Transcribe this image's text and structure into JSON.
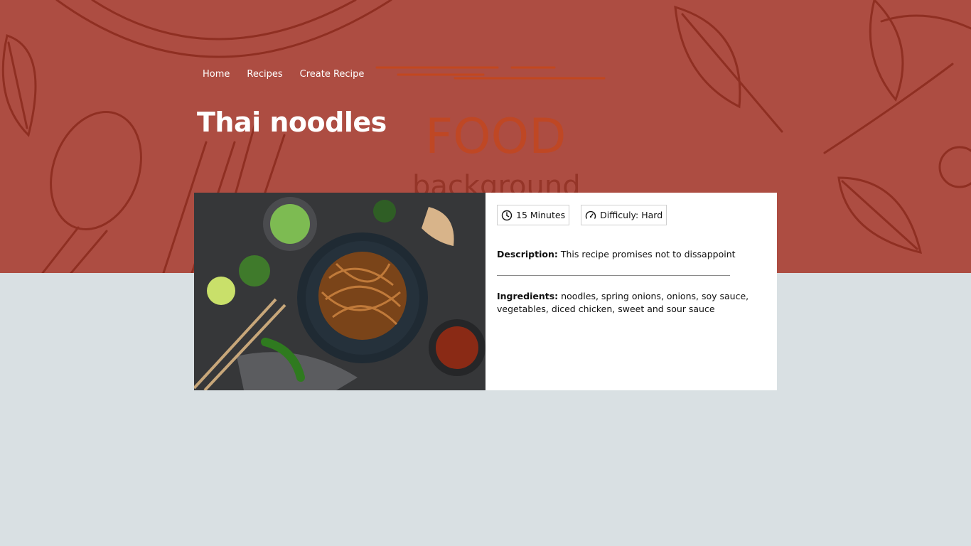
{
  "nav": {
    "items": [
      {
        "label": "Home"
      },
      {
        "label": "Recipes"
      },
      {
        "label": "Create Recipe"
      }
    ]
  },
  "hero": {
    "background_text_1": "FOOD",
    "background_text_2": "background",
    "color": "#ad4d42"
  },
  "recipe": {
    "title": "Thai noodles",
    "time": "15 Minutes",
    "difficulty": "Difficuly: Hard",
    "description_label": "Description:",
    "description": "This recipe promises not to dissappoint",
    "ingredients_label": "Ingredients:",
    "ingredients": "noodles, spring onions, onions, soy sauce, vegetables, diced chicken, sweet and sour sauce"
  },
  "icons": {
    "time": "clock-icon",
    "difficulty": "gauge-icon"
  },
  "colors": {
    "page_bg": "#d9e0e3",
    "card_bg": "#ffffff"
  }
}
